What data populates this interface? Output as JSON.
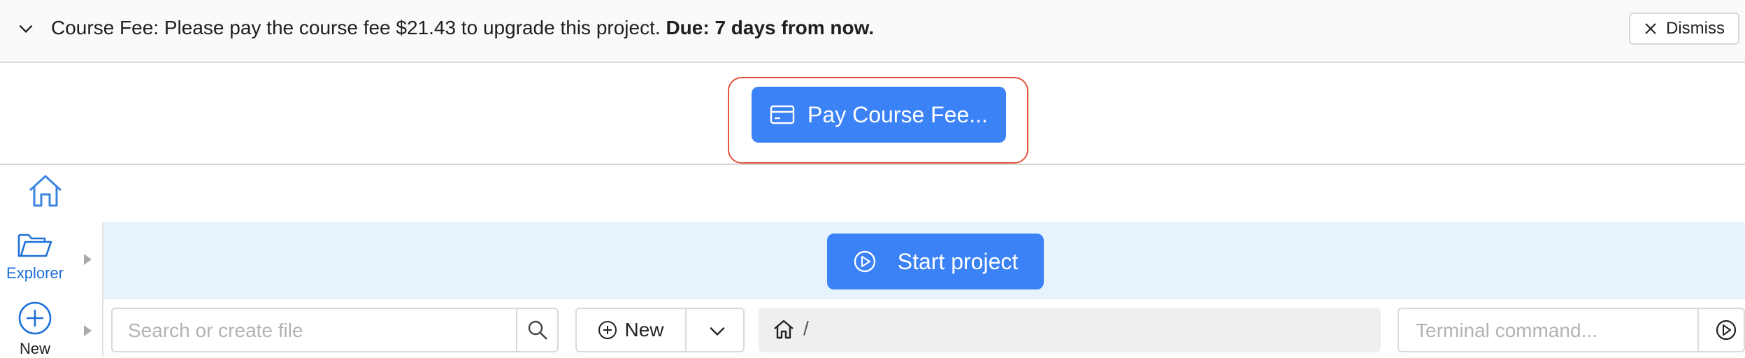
{
  "banner": {
    "message": "Course Fee: Please pay the course fee $21.43 to upgrade this project.",
    "due": "Due: 7 days from now.",
    "dismiss_label": "Dismiss"
  },
  "pay": {
    "button_label": "Pay Course Fee..."
  },
  "sidebar": {
    "items": [
      {
        "label": "Explorer",
        "icon": "folder-open-icon"
      },
      {
        "label": "New",
        "icon": "plus-circle-icon"
      }
    ]
  },
  "project": {
    "start_label": "Start project"
  },
  "toolbar": {
    "search_placeholder": "Search or create file",
    "new_label": "New",
    "path_separator": "/",
    "terminal_placeholder": "Terminal command..."
  },
  "colors": {
    "primary": "#3b82f6",
    "highlight": "#e2553d",
    "project_bar_bg": "#e6f2fc",
    "link_blue": "#1e6fd9"
  }
}
